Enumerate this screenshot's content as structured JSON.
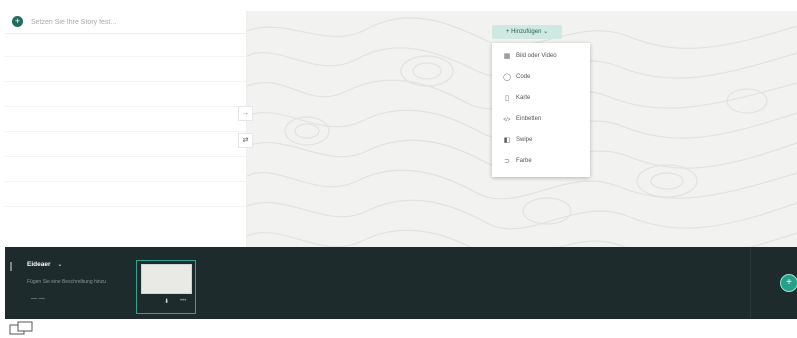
{
  "editor": {
    "story_title_placeholder": "Setzen Sie Ihre Story fest...",
    "add_icon": "plus-icon"
  },
  "map": {
    "tools": [
      {
        "name": "arrow-right-icon",
        "glyph": "→"
      },
      {
        "name": "swap-icon",
        "glyph": "⇄"
      }
    ]
  },
  "add_menu": {
    "button_label": "Hinzufügen",
    "items": [
      {
        "icon": "image-video-icon",
        "glyph": "▦",
        "label": "Bild oder Video"
      },
      {
        "icon": "code-icon",
        "glyph": "◯",
        "label": "Code"
      },
      {
        "icon": "map-icon",
        "glyph": "▯",
        "label": "Karte"
      },
      {
        "icon": "embed-icon",
        "glyph": "</>",
        "label": "Einbetten"
      },
      {
        "icon": "swipe-icon",
        "glyph": "◧",
        "label": "Swipe"
      },
      {
        "icon": "color-icon",
        "glyph": "⊃",
        "label": "Farbe"
      }
    ]
  },
  "slides": {
    "current_name": "Eideaer",
    "description": "Fügen Sie eine Beschreibung hinzu",
    "dash": "— —",
    "thumb_icon": "⬇",
    "thumb_more": "•••"
  },
  "colors": {
    "accent": "#27a08a",
    "dark": "#1e2b2c",
    "menu_button_bg": "#cfe9e2"
  }
}
